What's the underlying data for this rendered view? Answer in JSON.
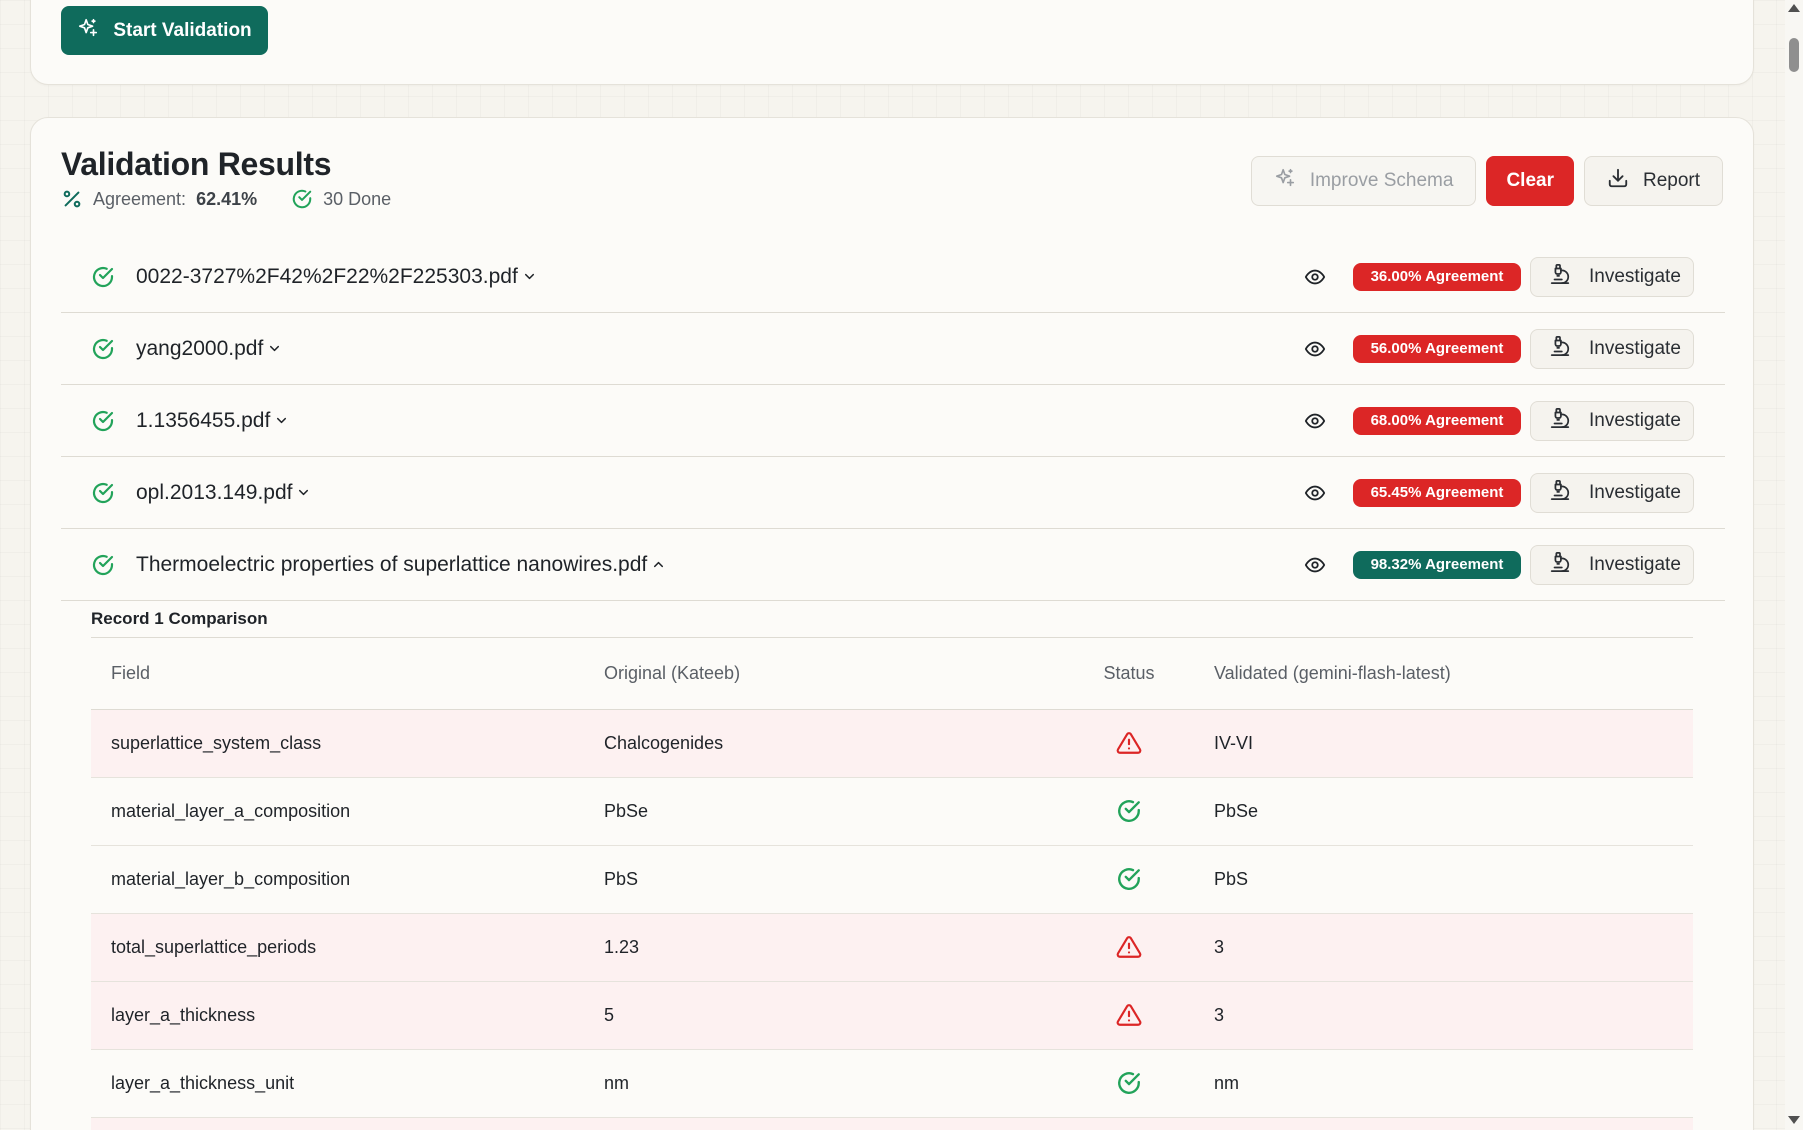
{
  "toolbar": {
    "start_label": "Start Validation"
  },
  "results": {
    "title": "Validation Results",
    "agreement_label": "Agreement:",
    "agreement_value": "62.41%",
    "done_label": "30 Done",
    "improve_label": "Improve Schema",
    "clear_label": "Clear",
    "report_label": "Report"
  },
  "files": [
    {
      "name": "0022-3727%2F42%2F22%2F225303.pdf",
      "agreement": "36.00% Agreement",
      "agreement_value": 36.0,
      "status": "bad",
      "expanded": false,
      "action": "Investigate"
    },
    {
      "name": "yang2000.pdf",
      "agreement": "56.00% Agreement",
      "agreement_value": 56.0,
      "status": "bad",
      "expanded": false,
      "action": "Investigate"
    },
    {
      "name": "1.1356455.pdf",
      "agreement": "68.00% Agreement",
      "agreement_value": 68.0,
      "status": "bad",
      "expanded": false,
      "action": "Investigate"
    },
    {
      "name": "opl.2013.149.pdf",
      "agreement": "65.45% Agreement",
      "agreement_value": 65.45,
      "status": "bad",
      "expanded": false,
      "action": "Investigate"
    },
    {
      "name": "Thermoelectric properties of superlattice nanowires.pdf",
      "agreement": "98.32% Agreement",
      "agreement_value": 98.32,
      "status": "good",
      "expanded": true,
      "action": "Investigate"
    }
  ],
  "record": {
    "title": "Record 1 Comparison",
    "headers": {
      "field": "Field",
      "original": "Original (Kateeb)",
      "status": "Status",
      "validated": "Validated (gemini-flash-latest)"
    },
    "rows": [
      {
        "field": "superlattice_system_class",
        "original": "Chalcogenides",
        "match": false,
        "validated": "IV-VI"
      },
      {
        "field": "material_layer_a_composition",
        "original": "PbSe",
        "match": true,
        "validated": "PbSe"
      },
      {
        "field": "material_layer_b_composition",
        "original": "PbS",
        "match": true,
        "validated": "PbS"
      },
      {
        "field": "total_superlattice_periods",
        "original": "1.23",
        "match": false,
        "validated": "3"
      },
      {
        "field": "layer_a_thickness",
        "original": "5",
        "match": false,
        "validated": "3"
      },
      {
        "field": "layer_a_thickness_unit",
        "original": "nm",
        "match": true,
        "validated": "nm"
      },
      {
        "field": "",
        "original": "",
        "match": false,
        "validated": ""
      }
    ]
  },
  "colors": {
    "primary": "#0f6b5c",
    "danger": "#dc2626",
    "success": "#22a35a",
    "mismatch_row": "#fdf1f1"
  }
}
